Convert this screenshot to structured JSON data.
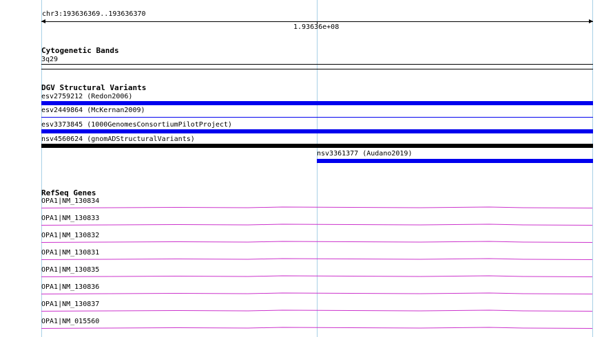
{
  "locus": "chr3:193636369..193636370",
  "ruler": {
    "tick_label": "1.93636e+08"
  },
  "tracks": {
    "cytoband": {
      "title": "Cytogenetic Bands",
      "band": "3q29"
    },
    "dgv": {
      "title": "DGV Structural Variants",
      "variants": [
        {
          "label": "esv2759212 (Redon2006)",
          "color": "#0000ee"
        },
        {
          "label": "esv2449864 (McKernan2009)",
          "color": "#0000ee"
        },
        {
          "label": "esv3373845 (1000GenomesConsortiumPilotProject)",
          "color": "#0000ee"
        },
        {
          "label": "nsv4560624 (gnomADStructuralVariants)",
          "color": "#000000"
        },
        {
          "label": "nsv3361377 (Audano2019)",
          "color": "#0000ee"
        }
      ]
    },
    "refseq": {
      "title": "RefSeq Genes",
      "genes": [
        "OPA1|NM_130834",
        "OPA1|NM_130833",
        "OPA1|NM_130832",
        "OPA1|NM_130831",
        "OPA1|NM_130835",
        "OPA1|NM_130836",
        "OPA1|NM_130837",
        "OPA1|NM_015560"
      ],
      "color": "#cc33cc"
    }
  },
  "colors": {
    "guide": "#a8d0e6",
    "variant_blue": "#0000ee",
    "variant_black": "#000000",
    "gene": "#cc33cc"
  }
}
